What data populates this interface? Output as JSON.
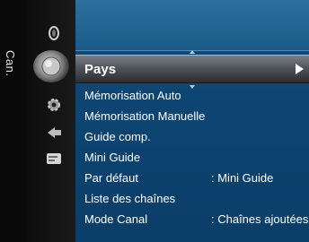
{
  "rail_label": "Can.",
  "selected": {
    "label": "Pays"
  },
  "items": [
    {
      "label": "Mémorisation Auto",
      "value": ""
    },
    {
      "label": "Mémorisation Manuelle",
      "value": ""
    },
    {
      "label": "Guide comp.",
      "value": ""
    },
    {
      "label": "Mini Guide",
      "value": ""
    },
    {
      "label": "Par défaut",
      "value": ": Mini Guide"
    },
    {
      "label": "Liste des chaînes",
      "value": ""
    },
    {
      "label": "Mode Canal",
      "value": ": Chaînes ajoutées"
    }
  ],
  "icons": [
    "picture-icon",
    "channel-icon",
    "setup-icon",
    "input-icon",
    "application-icon"
  ]
}
